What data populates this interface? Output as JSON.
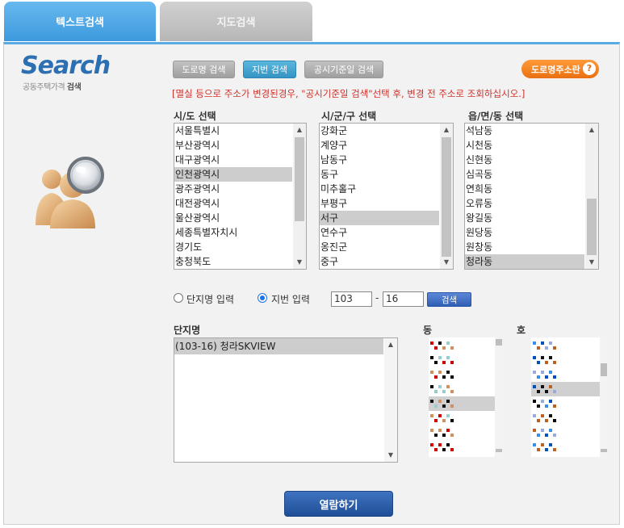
{
  "tabs": {
    "text_search": "텍스트검색",
    "map_search": "지도검색"
  },
  "logo": {
    "title": "Search",
    "subtitle": "공동주택가격",
    "subtitle_bold": "검색"
  },
  "modes": {
    "road": "도로명 검색",
    "jibun": "지번 검색",
    "notice_date": "공시기준일 검색",
    "active": "jibun"
  },
  "road_address_link": {
    "label": "도로명주소란",
    "icon": "question-icon"
  },
  "notice": "[멸실 등으로 주소가 변경된경우, \"공시기준일 검색\"선택 후, 변경 전 주소로 조회하십시오.]",
  "sido": {
    "header": "시/도 선택",
    "items": [
      "서울특별시",
      "부산광역시",
      "대구광역시",
      "인천광역시",
      "광주광역시",
      "대전광역시",
      "울산광역시",
      "세종특별자치시",
      "경기도",
      "충청북도"
    ],
    "selected": "인천광역시"
  },
  "sigungu": {
    "header": "시/군/구 선택",
    "items": [
      "강화군",
      "계양구",
      "남동구",
      "동구",
      "미추홀구",
      "부평구",
      "서구",
      "연수구",
      "옹진군",
      "중구"
    ],
    "selected": "서구"
  },
  "dong": {
    "header": "읍/면/동 선택",
    "items": [
      "석남동",
      "시천동",
      "신현동",
      "심곡동",
      "연희동",
      "오류동",
      "왕길동",
      "원당동",
      "원창동",
      "청라동"
    ],
    "selected": "청라동"
  },
  "input_mode": {
    "complex_name": "단지명 입력",
    "jibun": "지번 입력",
    "selected": "jibun"
  },
  "jibun_inputs": {
    "main": "103",
    "dash": "-",
    "sub": "16"
  },
  "search_button": "검색",
  "complex": {
    "header": "단지명",
    "items": [
      "(103-16) 청라SKVIEW"
    ],
    "selected": "(103-16) 청라SKVIEW"
  },
  "building": {
    "header": "동"
  },
  "unit": {
    "header": "호"
  },
  "view_button": "열람하기"
}
